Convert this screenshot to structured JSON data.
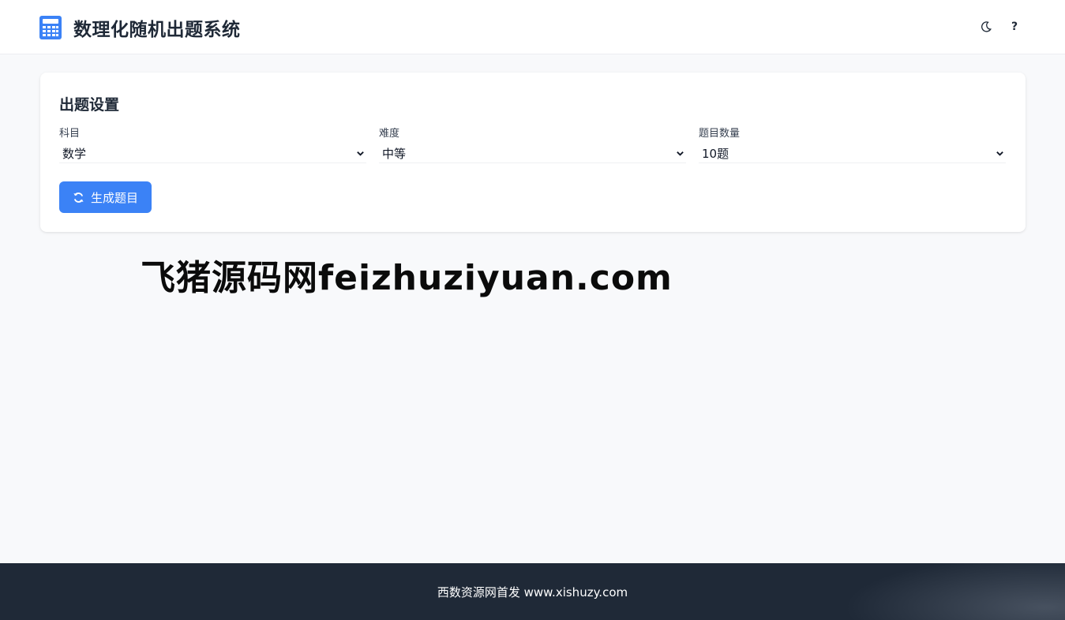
{
  "header": {
    "title": "数理化随机出题系统",
    "icons": {
      "brand": "calculator-icon",
      "theme": "moon-icon",
      "help": "question-icon"
    },
    "help_label": "?"
  },
  "settings": {
    "title": "出题设置",
    "subject": {
      "label": "科目",
      "value": "数学"
    },
    "difficulty": {
      "label": "难度",
      "value": "中等"
    },
    "count": {
      "label": "题目数量",
      "value": "10题"
    },
    "generate_label": "生成题目",
    "generate_icon": "refresh-icon"
  },
  "watermark": "飞猪源码网feizhuziyuan.com",
  "footer": {
    "text": "西数资源网首发 www.xishuzy.com"
  },
  "colors": {
    "accent": "#3b82f6",
    "background": "#f8f9fb",
    "footer": "#1f2937",
    "text": "#1f2937"
  }
}
